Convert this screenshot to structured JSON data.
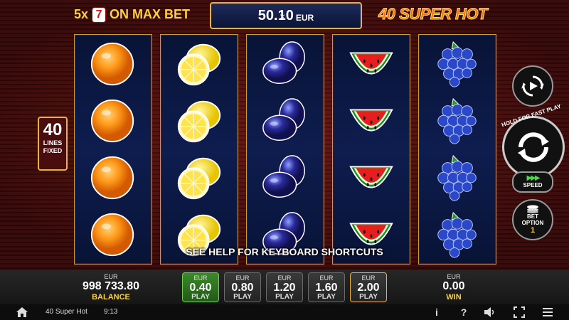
{
  "header": {
    "max_bet_prefix": "5x",
    "max_bet_symbol": "7",
    "max_bet_suffix": "ON MAX BET",
    "jackpot_value": "50.10",
    "jackpot_currency": "EUR",
    "jackpot_close_glyph": "×",
    "logo": "40 SUPER HOT"
  },
  "reels": [
    {
      "symbol": "orange",
      "rows": 4
    },
    {
      "symbol": "lemon",
      "rows": 4
    },
    {
      "symbol": "plum",
      "rows": 4
    },
    {
      "symbol": "watermelon",
      "rows": 4
    },
    {
      "symbol": "grapes",
      "rows": 4
    }
  ],
  "lines": {
    "count": "40",
    "label_1": "LINES",
    "label_2": "FIXED"
  },
  "controls": {
    "spin_caption": "HOLD FOR FAST PLAY",
    "speed_icon": "▶▶▶",
    "speed_label": "SPEED",
    "option_label_1": "BET",
    "option_label_2": "OPTION",
    "option_value": "1"
  },
  "help_text": "SEE HELP FOR KEYBOARD SHORTCUTS",
  "balance": {
    "currency": "EUR",
    "amount": "998 733.80",
    "label": "BALANCE"
  },
  "bets": [
    {
      "currency": "EUR",
      "amount": "0.40",
      "label": "PLAY"
    },
    {
      "currency": "EUR",
      "amount": "0.80",
      "label": "PLAY"
    },
    {
      "currency": "EUR",
      "amount": "1.20",
      "label": "PLAY"
    },
    {
      "currency": "EUR",
      "amount": "1.60",
      "label": "PLAY"
    },
    {
      "currency": "EUR",
      "amount": "2.00",
      "label": "PLAY"
    }
  ],
  "win": {
    "currency": "EUR",
    "amount": "0.00",
    "label": "WIN"
  },
  "system": {
    "title": "40 Super Hot",
    "time": "9:13",
    "info_glyph": "i",
    "help_glyph": "?"
  },
  "colors": {
    "accent_gold": "#e8b537",
    "label_yellow": "#ffd23a",
    "active_bet_green": "#3c8a2a",
    "reel_bg": "#0e1d4f"
  }
}
